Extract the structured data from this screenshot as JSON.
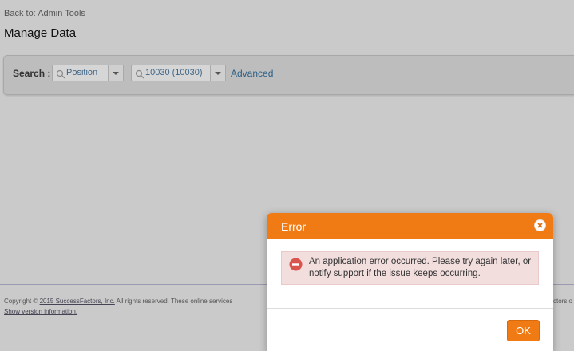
{
  "nav": {
    "back_link": "Back to: Admin Tools",
    "page_title": "Manage Data"
  },
  "search": {
    "label": "Search :",
    "type_value": "Position",
    "id_value": "10030 (10030)",
    "advanced_link": "Advanced"
  },
  "footer": {
    "copyright_prefix": "Copyright © ",
    "copyright_link": "2015 SuccessFactors, Inc.",
    "copyright_suffix": " All rights reserved. These online services",
    "copyright_right_fragment": "ctors o",
    "version_link": "Show version information."
  },
  "dialog": {
    "title": "Error",
    "message": "An application error occurred. Please try again later, or notify support if the issue keeps occurring.",
    "ok_label": "OK"
  },
  "colors": {
    "dialog_header": "#f07a14",
    "ok_button": "#f07a14",
    "error_box_bg": "#f3dede",
    "error_icon": "#d9534f",
    "link": "#2d5f86"
  },
  "icons": {
    "close": "close-icon",
    "error": "error-icon",
    "search": "search-icon",
    "dropdown": "chevron-down-icon"
  }
}
